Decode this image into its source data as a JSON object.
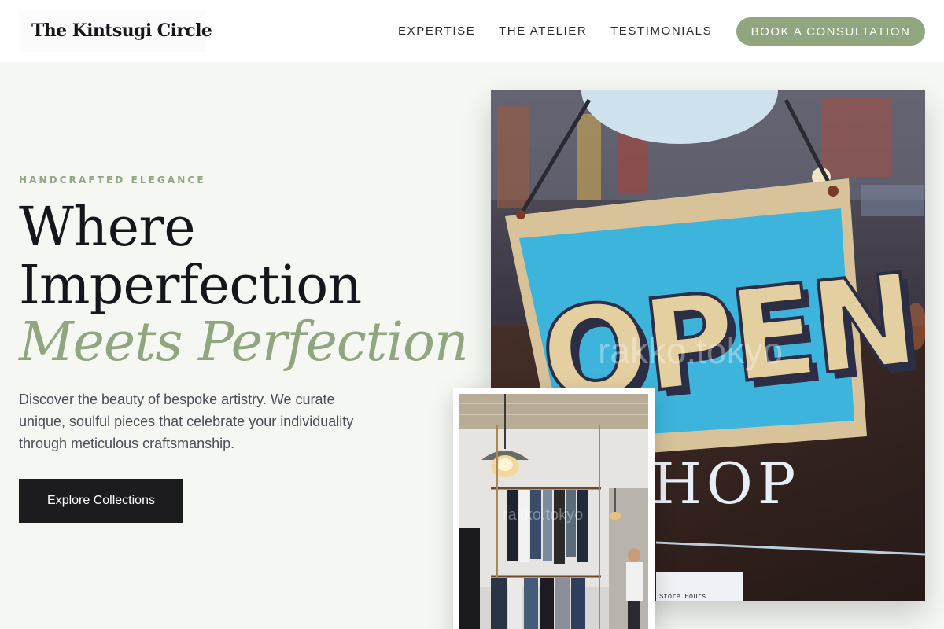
{
  "header": {
    "logo": "The Kintsugi Circle",
    "nav": [
      "EXPERTISE",
      "THE ATELIER",
      "TESTIMONIALS"
    ],
    "cta": "BOOK A CONSULTATION"
  },
  "hero": {
    "eyebrow": "HANDCRAFTED ELEGANCE",
    "headline_line1": "Where",
    "headline_line2": "Imperfection",
    "headline_accent": "Meets Perfection",
    "description": "Discover the beauty of bespoke artistry. We curate unique, soulful pieces that celebrate your individuality through meticulous craftsmanship.",
    "button": "Explore Collections"
  },
  "images": {
    "main_photo": {
      "sign_text": "OPEN",
      "window_text": "HOP",
      "watermark": "rakko.tokyo",
      "small_tag": "Store Hours"
    },
    "secondary_photo": {
      "watermark": "rakko.tokyo"
    }
  },
  "colors": {
    "accent": "#8fa67e",
    "page_bg": "#f4f7f2",
    "ink": "#15161c",
    "button_dark": "#1c1c1e"
  }
}
